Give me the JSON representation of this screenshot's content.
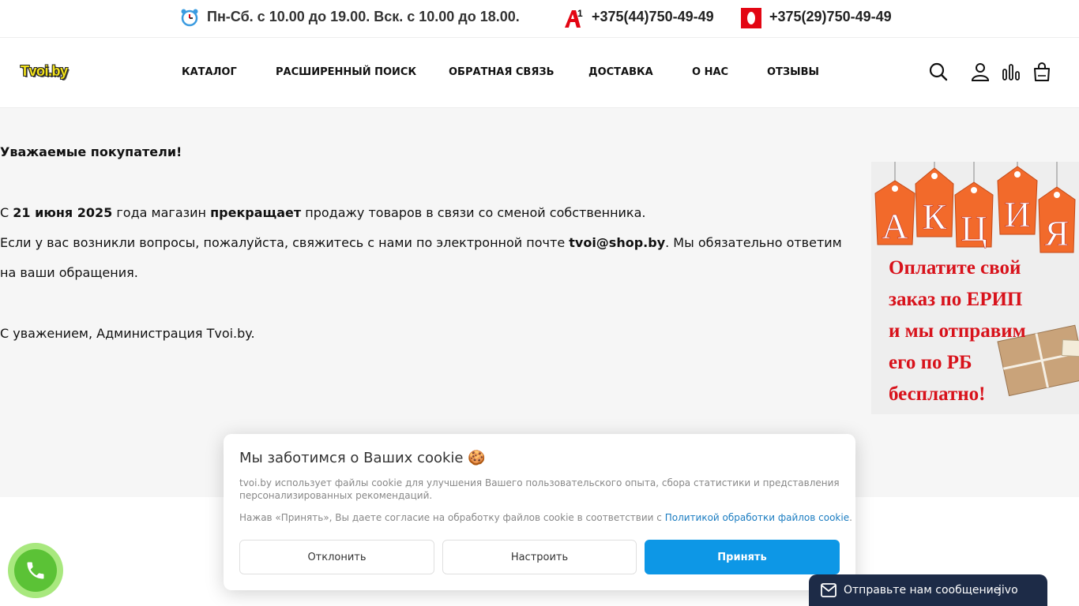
{
  "topbar": {
    "hours": "Пн-Сб. с 10.00 до 19.00. Вск. с 10.00 до 18.00.",
    "phone1": "+375(44)750-49-49",
    "phone2": "+375(29)750-49-49",
    "operator1_glyph": "A1",
    "clock_icon": "alarm-clock-icon",
    "accent_red": "#e30613",
    "clock_blue": "#3a9be0"
  },
  "header": {
    "logo": "Tvoi.by",
    "nav": [
      "КАТАЛОГ",
      "РАСШИРЕННЫЙ ПОИСК",
      "ОБРАТНАЯ СВЯЗЬ",
      "ДОСТАВКА",
      "О НАС",
      "ОТЗЫВЫ"
    ],
    "icons": [
      "search-icon",
      "user-icon",
      "compare-icon",
      "cart-icon"
    ]
  },
  "notice": {
    "greeting": "Уважаемые покупатели!",
    "l1_pre": "С ",
    "l1_date": "21 июня 2025",
    "l1_mid": " года магазин ",
    "l1_verb": "прекращает",
    "l1_post": " продажу товаров в связи со сменой собственника.",
    "l2_pre": "Если у вас возникли вопросы, пожалуйста, свяжитесь с нами по электронной почте ",
    "l2_email": "tvoi@shop.by",
    "l2_post": ". Мы обязательно ответим",
    "l3": "на ваши обращения.",
    "signature": "С уважением, Администрация Tvoi.by."
  },
  "promo": {
    "tags": [
      "А",
      "К",
      "Ц",
      "И",
      "Я"
    ],
    "lines": [
      "Оплатите свой",
      "заказ по ЕРИП",
      "и мы отправим",
      "его по РБ",
      "бесплатно!"
    ],
    "text_color": "#d8121b",
    "tag_color": "#f26a2b"
  },
  "cookie": {
    "title": "Мы заботимся о Ваших cookie 🍪",
    "text": "tvoi.by использует файлы cookie для улучшения Вашего пользовательского опыта, сбора статистики и представления персонализированных рекомендаций.",
    "consent_pre": "Нажав «Принять», Вы даете согласие на обработку файлов cookie в соответствии с ",
    "consent_link": "Политикой обработки файлов cookie",
    "consent_post": ".",
    "decline": "Отклонить",
    "configure": "Настроить",
    "accept": "Принять",
    "accent": "#0d97e6"
  },
  "callback": {
    "icon": "phone-icon",
    "color": "#5bc236"
  },
  "chat": {
    "text": "Отправьте нам сообщение",
    "brand": "jivo",
    "icon": "envelope-icon",
    "bg": "#1d2b47"
  }
}
